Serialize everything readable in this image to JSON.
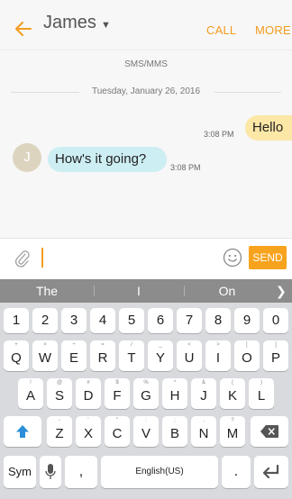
{
  "header": {
    "contact_name": "James",
    "call_label": "CALL",
    "more_label": "MORE"
  },
  "conversation": {
    "channel_label": "SMS/MMS",
    "date_label": "Tuesday, January 26, 2016",
    "messages": [
      {
        "direction": "outgoing",
        "text": "Hello",
        "time": "3:08 PM"
      },
      {
        "direction": "incoming",
        "text": "How's it going?",
        "time": "3:08 PM",
        "avatar_initial": "J"
      }
    ]
  },
  "compose": {
    "send_label": "SEND",
    "attach_icon": "paperclip-icon",
    "emoji_icon": "smiley-icon"
  },
  "suggestions": [
    "The",
    "I",
    "On"
  ],
  "keyboard": {
    "row_numbers": [
      "1",
      "2",
      "3",
      "4",
      "5",
      "6",
      "7",
      "8",
      "9",
      "0"
    ],
    "row1": [
      {
        "k": "Q",
        "s": "+"
      },
      {
        "k": "W",
        "s": "×"
      },
      {
        "k": "E",
        "s": "÷"
      },
      {
        "k": "R",
        "s": "="
      },
      {
        "k": "T",
        "s": "/"
      },
      {
        "k": "Y",
        "s": "_"
      },
      {
        "k": "U",
        "s": "<"
      },
      {
        "k": "I",
        "s": ">"
      },
      {
        "k": "O",
        "s": "["
      },
      {
        "k": "P",
        "s": "]"
      }
    ],
    "row2": [
      {
        "k": "A",
        "s": "!"
      },
      {
        "k": "S",
        "s": "@"
      },
      {
        "k": "D",
        "s": "#"
      },
      {
        "k": "F",
        "s": "$"
      },
      {
        "k": "G",
        "s": "%"
      },
      {
        "k": "H",
        "s": "^"
      },
      {
        "k": "J",
        "s": "&"
      },
      {
        "k": "K",
        "s": "("
      },
      {
        "k": "L",
        "s": ")"
      }
    ],
    "row3": [
      {
        "k": "Z",
        "s": "-"
      },
      {
        "k": "X",
        "s": "'"
      },
      {
        "k": "C",
        "s": "\""
      },
      {
        "k": "V",
        "s": ":"
      },
      {
        "k": "B",
        "s": ";"
      },
      {
        "k": "N",
        "s": ","
      },
      {
        "k": "M",
        "s": "?"
      }
    ],
    "sym_label": "Sym",
    "comma_label": ",",
    "space_label": "English(US)",
    "period_label": ".",
    "shift_icon": "shift-up-arrow-icon",
    "backspace_icon": "backspace-icon",
    "mic_icon": "microphone-icon",
    "enter_icon": "enter-return-icon"
  },
  "colors": {
    "accent": "#f39c1f",
    "send_bg": "#f7a31e",
    "outgoing_bubble": "#fce7a6",
    "incoming_bubble": "#cdeef3",
    "keyboard_bg": "#d8dadd",
    "suggestion_bar": "#8c8c8c",
    "shift_blue": "#2a8fd8"
  }
}
